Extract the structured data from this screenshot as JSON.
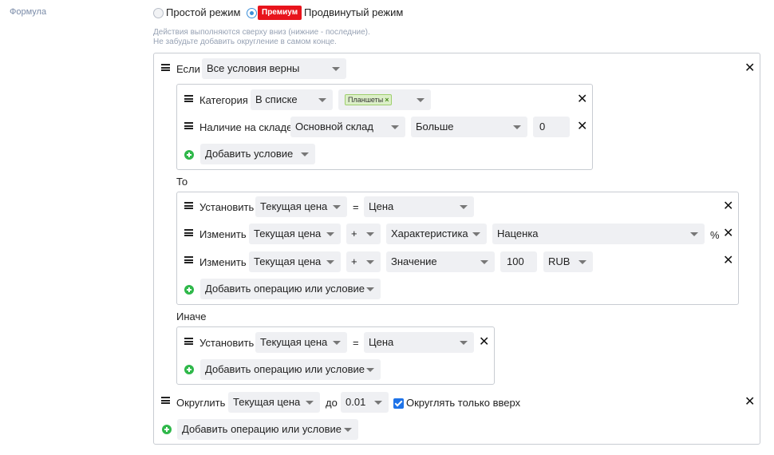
{
  "field_label": "Формула",
  "mode": {
    "simple_label": "Простой режим",
    "premium_badge": "Премиум",
    "advanced_label": "Продвинутый режим",
    "selected": "advanced"
  },
  "hint": {
    "line1": "Действия выполняются сверху вниз (нижние - последние).",
    "line2": "Не забудьте добавить округление в самом конце."
  },
  "if_block": {
    "label": "Если",
    "mode_select": "Все условия верны",
    "conditions": [
      {
        "label": "Категория",
        "operator": "В списке",
        "tag": "Планшеты"
      },
      {
        "label": "Наличие на складе",
        "warehouse": "Основной склад",
        "comparison": "Больше",
        "value": "0"
      }
    ],
    "add_label": "Добавить условие"
  },
  "then_block": {
    "label": "То",
    "ops": [
      {
        "action": "Установить",
        "target": "Текущая цена",
        "op": "=",
        "source": "Цена"
      },
      {
        "action": "Изменить",
        "target": "Текущая цена",
        "op": "+",
        "source": "Характеристика",
        "attribute": "Наценка",
        "unit": "%"
      },
      {
        "action": "Изменить",
        "target": "Текущая цена",
        "op": "+",
        "source": "Значение",
        "value": "100",
        "currency": "RUB"
      }
    ],
    "add_label": "Добавить операцию или условие"
  },
  "else_block": {
    "label": "Иначе",
    "ops": [
      {
        "action": "Установить",
        "target": "Текущая цена",
        "op": "=",
        "source": "Цена"
      }
    ],
    "add_label": "Добавить операцию или условие"
  },
  "round": {
    "label": "Округлить",
    "target": "Текущая цена",
    "to_label": "до",
    "precision": "0.01",
    "up_only_label": "Округлять только вверх",
    "up_only_checked": true
  },
  "bottom_add_label": "Добавить операцию или условие",
  "colors": {
    "accent": "#1e73e8",
    "premium": "#e8141c",
    "add": "#2fb84a",
    "tag_bg": "#dcefc8"
  }
}
